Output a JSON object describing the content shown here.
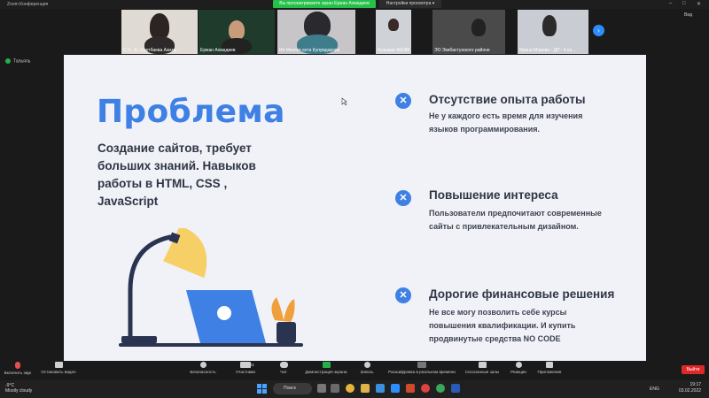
{
  "window": {
    "title": "Zoom Конференция",
    "share_banner": "Вы просматриваете экран Ержан Ахмадиев",
    "view_options": "Настройки просмотра ▾",
    "view_button": "Вид"
  },
  "participants": [
    {
      "name": "С.У... Е. Сартбаева Азиза...",
      "color": "#dcd6d0"
    },
    {
      "name": "Ержан Ахмадиев",
      "color": "#1f3b2c"
    },
    {
      "name": "Ия Мектеп ахта Кулумдарова",
      "color": "#c8c5c8"
    },
    {
      "name": "Кульжан ЖЕЗМ",
      "color": "#cfd2d6"
    },
    {
      "name": "ЭО Экибастузского районе",
      "color": "#5a5a5a"
    },
    {
      "name": "Ирина Морева - ДП - 4 кл...",
      "color": "#c9ccd2"
    }
  ],
  "speaking": {
    "label": "Тальяль"
  },
  "slide": {
    "title": "Проблема",
    "subtitle": "Создание сайтов, требует больших знаний. Навыков работы в HTML, CSS , JavaScript",
    "items": [
      {
        "heading": "Отсутствие опыта работы",
        "text": "Не у каждого есть время для изучения языков программирования."
      },
      {
        "heading": "Повышение интереса",
        "text": "Пользователи предпочитают современные сайты с привлекательным дизайном."
      },
      {
        "heading": "Дорогие финансовые решения",
        "text": "Не все могу позволить себе курсы повышения квалификации. И купить продвинутые средства NO CODE"
      }
    ]
  },
  "toolbar": {
    "mute": "Включить звук",
    "video": "Остановить видео",
    "security": "Безопасность",
    "participants": "Участники",
    "participants_count": "31",
    "chat": "Чат",
    "share": "Демонстрация экрана",
    "record": "Запись",
    "captions": "Расшифровка в реальном времени",
    "rooms": "Сессионные залы",
    "reactions": "Реакции",
    "apps": "Приложения",
    "end": "Выйти"
  },
  "taskbar": {
    "temp": "-9°C",
    "weather": "Mostly cloudy",
    "search": "Поиск",
    "lang": "ENG",
    "time": "19:17",
    "date": "03.02.2022"
  }
}
